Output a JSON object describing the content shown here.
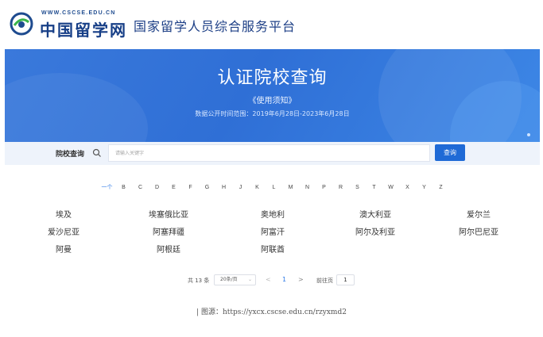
{
  "header": {
    "logo_url": "WWW.CSCSE.EDU.CN",
    "logo_cn": "中国留学网",
    "site_title": "国家留学人员综合服务平台"
  },
  "banner": {
    "title": "认证院校查询",
    "notice": "《使用须知》",
    "range": "数据公开时间范围：2019年6月28日-2023年6月28日"
  },
  "search": {
    "label": "院校查询",
    "placeholder": "请输入关键字",
    "button": "查询"
  },
  "letters": [
    "一个",
    "B",
    "C",
    "D",
    "E",
    "F",
    "G",
    "H",
    "J",
    "K",
    "L",
    "M",
    "N",
    "P",
    "R",
    "S",
    "T",
    "W",
    "X",
    "Y",
    "Z"
  ],
  "countries": [
    [
      "埃及",
      "埃塞俄比亚",
      "奥地利",
      "澳大利亚",
      "爱尔兰"
    ],
    [
      "爱沙尼亚",
      "阿塞拜疆",
      "阿富汗",
      "阿尔及利亚",
      "阿尔巴尼亚"
    ],
    [
      "阿曼",
      "阿根廷",
      "阿联酋"
    ]
  ],
  "pagination": {
    "total": "共 13 条",
    "page_size": "20条/页",
    "current": "1",
    "prev": "<",
    "next": ">",
    "goto_label": "前往页",
    "goto_value": "1"
  },
  "caption": "| 图源：https://yxcx.cscse.edu.cn/rzyxmd2",
  "colors": {
    "brand_blue": "#1d3f86",
    "banner_blue": "#3a79db",
    "button_blue": "#1f6ad6",
    "active_link": "#2f7be6"
  }
}
